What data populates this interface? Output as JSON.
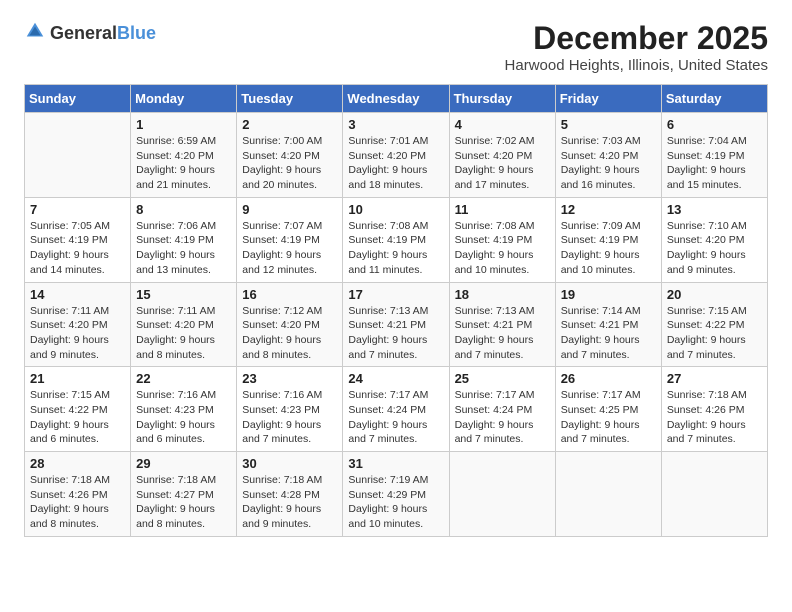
{
  "logo": {
    "text_general": "General",
    "text_blue": "Blue"
  },
  "title": "December 2025",
  "subtitle": "Harwood Heights, Illinois, United States",
  "days_of_week": [
    "Sunday",
    "Monday",
    "Tuesday",
    "Wednesday",
    "Thursday",
    "Friday",
    "Saturday"
  ],
  "weeks": [
    [
      {
        "day": "",
        "info": ""
      },
      {
        "day": "1",
        "info": "Sunrise: 6:59 AM\nSunset: 4:20 PM\nDaylight: 9 hours\nand 21 minutes."
      },
      {
        "day": "2",
        "info": "Sunrise: 7:00 AM\nSunset: 4:20 PM\nDaylight: 9 hours\nand 20 minutes."
      },
      {
        "day": "3",
        "info": "Sunrise: 7:01 AM\nSunset: 4:20 PM\nDaylight: 9 hours\nand 18 minutes."
      },
      {
        "day": "4",
        "info": "Sunrise: 7:02 AM\nSunset: 4:20 PM\nDaylight: 9 hours\nand 17 minutes."
      },
      {
        "day": "5",
        "info": "Sunrise: 7:03 AM\nSunset: 4:20 PM\nDaylight: 9 hours\nand 16 minutes."
      },
      {
        "day": "6",
        "info": "Sunrise: 7:04 AM\nSunset: 4:19 PM\nDaylight: 9 hours\nand 15 minutes."
      }
    ],
    [
      {
        "day": "7",
        "info": "Sunrise: 7:05 AM\nSunset: 4:19 PM\nDaylight: 9 hours\nand 14 minutes."
      },
      {
        "day": "8",
        "info": "Sunrise: 7:06 AM\nSunset: 4:19 PM\nDaylight: 9 hours\nand 13 minutes."
      },
      {
        "day": "9",
        "info": "Sunrise: 7:07 AM\nSunset: 4:19 PM\nDaylight: 9 hours\nand 12 minutes."
      },
      {
        "day": "10",
        "info": "Sunrise: 7:08 AM\nSunset: 4:19 PM\nDaylight: 9 hours\nand 11 minutes."
      },
      {
        "day": "11",
        "info": "Sunrise: 7:08 AM\nSunset: 4:19 PM\nDaylight: 9 hours\nand 10 minutes."
      },
      {
        "day": "12",
        "info": "Sunrise: 7:09 AM\nSunset: 4:19 PM\nDaylight: 9 hours\nand 10 minutes."
      },
      {
        "day": "13",
        "info": "Sunrise: 7:10 AM\nSunset: 4:20 PM\nDaylight: 9 hours\nand 9 minutes."
      }
    ],
    [
      {
        "day": "14",
        "info": "Sunrise: 7:11 AM\nSunset: 4:20 PM\nDaylight: 9 hours\nand 9 minutes."
      },
      {
        "day": "15",
        "info": "Sunrise: 7:11 AM\nSunset: 4:20 PM\nDaylight: 9 hours\nand 8 minutes."
      },
      {
        "day": "16",
        "info": "Sunrise: 7:12 AM\nSunset: 4:20 PM\nDaylight: 9 hours\nand 8 minutes."
      },
      {
        "day": "17",
        "info": "Sunrise: 7:13 AM\nSunset: 4:21 PM\nDaylight: 9 hours\nand 7 minutes."
      },
      {
        "day": "18",
        "info": "Sunrise: 7:13 AM\nSunset: 4:21 PM\nDaylight: 9 hours\nand 7 minutes."
      },
      {
        "day": "19",
        "info": "Sunrise: 7:14 AM\nSunset: 4:21 PM\nDaylight: 9 hours\nand 7 minutes."
      },
      {
        "day": "20",
        "info": "Sunrise: 7:15 AM\nSunset: 4:22 PM\nDaylight: 9 hours\nand 7 minutes."
      }
    ],
    [
      {
        "day": "21",
        "info": "Sunrise: 7:15 AM\nSunset: 4:22 PM\nDaylight: 9 hours\nand 6 minutes."
      },
      {
        "day": "22",
        "info": "Sunrise: 7:16 AM\nSunset: 4:23 PM\nDaylight: 9 hours\nand 6 minutes."
      },
      {
        "day": "23",
        "info": "Sunrise: 7:16 AM\nSunset: 4:23 PM\nDaylight: 9 hours\nand 7 minutes."
      },
      {
        "day": "24",
        "info": "Sunrise: 7:17 AM\nSunset: 4:24 PM\nDaylight: 9 hours\nand 7 minutes."
      },
      {
        "day": "25",
        "info": "Sunrise: 7:17 AM\nSunset: 4:24 PM\nDaylight: 9 hours\nand 7 minutes."
      },
      {
        "day": "26",
        "info": "Sunrise: 7:17 AM\nSunset: 4:25 PM\nDaylight: 9 hours\nand 7 minutes."
      },
      {
        "day": "27",
        "info": "Sunrise: 7:18 AM\nSunset: 4:26 PM\nDaylight: 9 hours\nand 7 minutes."
      }
    ],
    [
      {
        "day": "28",
        "info": "Sunrise: 7:18 AM\nSunset: 4:26 PM\nDaylight: 9 hours\nand 8 minutes."
      },
      {
        "day": "29",
        "info": "Sunrise: 7:18 AM\nSunset: 4:27 PM\nDaylight: 9 hours\nand 8 minutes."
      },
      {
        "day": "30",
        "info": "Sunrise: 7:18 AM\nSunset: 4:28 PM\nDaylight: 9 hours\nand 9 minutes."
      },
      {
        "day": "31",
        "info": "Sunrise: 7:19 AM\nSunset: 4:29 PM\nDaylight: 9 hours\nand 10 minutes."
      },
      {
        "day": "",
        "info": ""
      },
      {
        "day": "",
        "info": ""
      },
      {
        "day": "",
        "info": ""
      }
    ]
  ]
}
